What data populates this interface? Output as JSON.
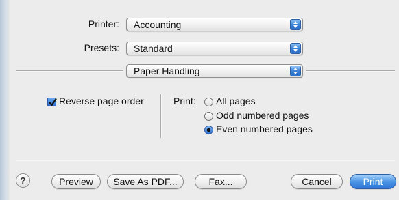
{
  "printer": {
    "label": "Printer:",
    "value": "Accounting"
  },
  "presets": {
    "label": "Presets:",
    "value": "Standard"
  },
  "pane": {
    "value": "Paper Handling"
  },
  "reverse_order": {
    "label": "Reverse page order",
    "checked": true
  },
  "print": {
    "label": "Print:",
    "options": [
      "All pages",
      "Odd numbered pages",
      "Even numbered pages"
    ],
    "selected": "Even numbered pages"
  },
  "buttons": {
    "help": "?",
    "preview": "Preview",
    "save_pdf": "Save As PDF...",
    "fax": "Fax...",
    "cancel": "Cancel",
    "print": "Print"
  },
  "colors": {
    "accent": "#3a82d6"
  },
  "icons": {
    "popup_arrows": "updown-arrows-icon",
    "check": "checkmark-icon",
    "help": "help-icon"
  }
}
